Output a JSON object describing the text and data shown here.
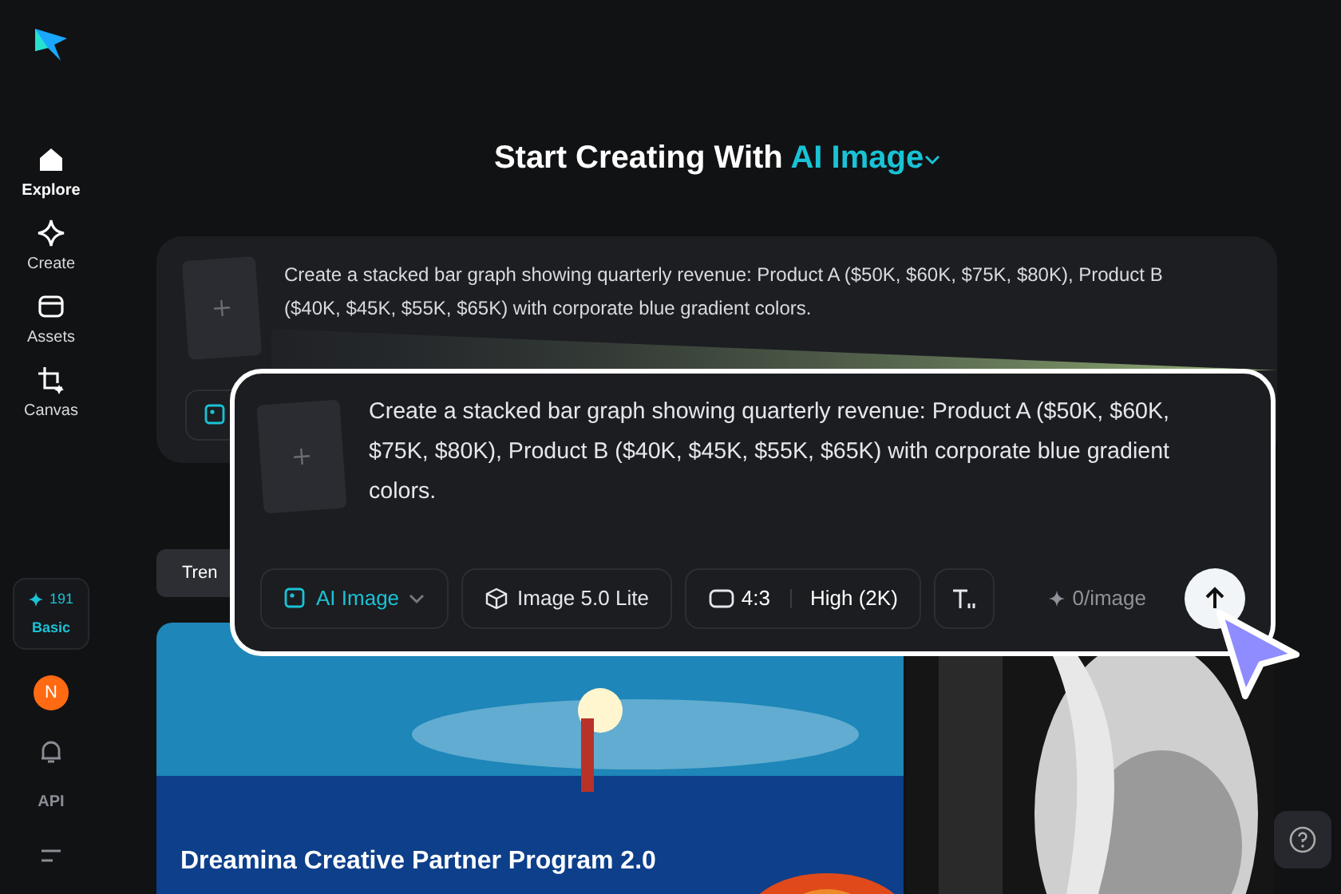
{
  "sidebar": {
    "items": [
      {
        "label": "Explore",
        "kind": "home",
        "selected": true
      },
      {
        "label": "Create",
        "kind": "sparkle",
        "selected": false
      },
      {
        "label": "Assets",
        "kind": "folder",
        "selected": false
      },
      {
        "label": "Canvas",
        "kind": "canvas",
        "selected": false
      }
    ],
    "credits": "191",
    "plan": "Basic",
    "avatar": "N",
    "api": "API"
  },
  "heading": {
    "text": "Start Creating With",
    "mode": "AI Image"
  },
  "prompt_card": {
    "text": "Create a stacked bar graph showing quarterly revenue: Product A ($50K, $60K, $75K, $80K), Product B ($40K, $45K, $55K, $65K) with corporate blue gradient colors."
  },
  "tabs": [
    {
      "label": "Tren",
      "selected": true
    }
  ],
  "banner": {
    "title": "Dreamina Creative Partner Program 2.0"
  },
  "callout": {
    "prompt": "Create a stacked bar graph showing quarterly revenue: Product A ($50K, $60K, $75K, $80K), Product B ($40K, $45K, $55K, $65K) with corporate blue gradient colors.",
    "mode": "AI Image",
    "model": "Image 5.0 Lite",
    "ratio": "4:3",
    "quality": "High (2K)",
    "cost": "0/image"
  }
}
